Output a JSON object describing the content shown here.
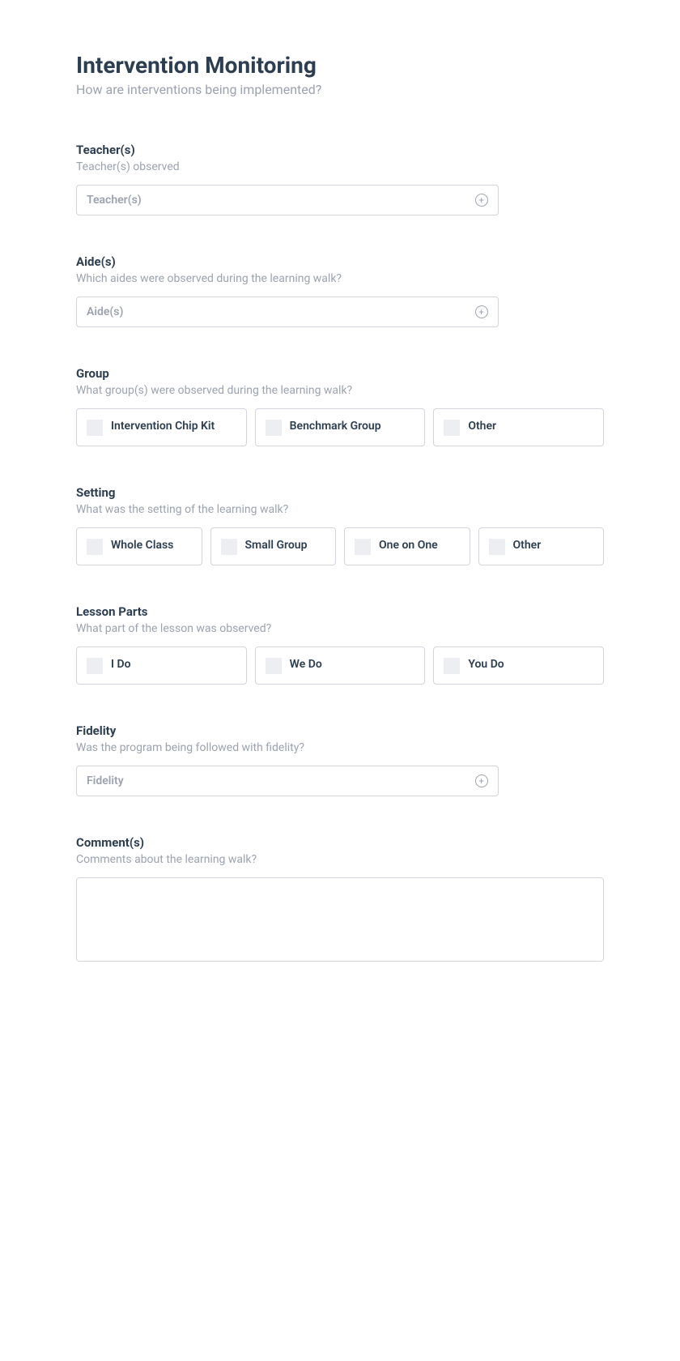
{
  "header": {
    "title": "Intervention Monitoring",
    "subtitle": "How are interventions being implemented?"
  },
  "teachers": {
    "label": "Teacher(s)",
    "desc": "Teacher(s) observed",
    "placeholder": "Teacher(s)"
  },
  "aides": {
    "label": "Aide(s)",
    "desc": "Which aides were observed during the learning walk?",
    "placeholder": "Aide(s)"
  },
  "group": {
    "label": "Group",
    "desc": "What group(s) were observed during the learning walk?",
    "options": [
      "Intervention Chip Kit",
      "Benchmark Group",
      "Other"
    ]
  },
  "setting": {
    "label": "Setting",
    "desc": "What was the setting of the learning walk?",
    "options": [
      "Whole Class",
      "Small Group",
      "One on One",
      "Other"
    ]
  },
  "lesson": {
    "label": "Lesson Parts",
    "desc": "What part of the lesson was observed?",
    "options": [
      "I Do",
      "We Do",
      "You Do"
    ]
  },
  "fidelity": {
    "label": "Fidelity",
    "desc": "Was the program being followed with fidelity?",
    "placeholder": "Fidelity"
  },
  "comments": {
    "label": "Comment(s)",
    "desc": "Comments about the learning walk?"
  }
}
